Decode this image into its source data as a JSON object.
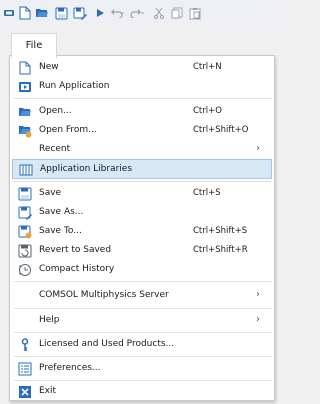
{
  "toolbar": {
    "icons": [
      "app-icon",
      "new-icon",
      "open-icon",
      "save-icon",
      "save-as-icon",
      "run-icon",
      "undo-icon",
      "redo-icon",
      "cut-icon",
      "copy-icon",
      "paste-icon"
    ]
  },
  "file_tab": {
    "label": "File"
  },
  "menu": {
    "new": {
      "label": "New",
      "shortcut": "Ctrl+N"
    },
    "run_application": {
      "label": "Run Application"
    },
    "open": {
      "label": "Open...",
      "shortcut": "Ctrl+O"
    },
    "open_from": {
      "label": "Open From...",
      "shortcut": "Ctrl+Shift+O"
    },
    "recent": {
      "label": "Recent",
      "arrow": "›"
    },
    "application_libraries": {
      "label": "Application Libraries"
    },
    "save": {
      "label": "Save",
      "shortcut": "Ctrl+S"
    },
    "save_as": {
      "label": "Save As..."
    },
    "save_to": {
      "label": "Save To...",
      "shortcut": "Ctrl+Shift+S"
    },
    "revert_to_saved": {
      "label": "Revert to Saved",
      "shortcut": "Ctrl+Shift+R"
    },
    "compact_history": {
      "label": "Compact History"
    },
    "comsol_server": {
      "label": "COMSOL Multiphysics Server",
      "arrow": "›"
    },
    "help": {
      "label": "Help",
      "arrow": "›"
    },
    "licensed_products": {
      "label": "Licensed and Used Products..."
    },
    "preferences": {
      "label": "Preferences..."
    },
    "exit": {
      "label": "Exit"
    }
  },
  "colors": {
    "highlight": "#d9e8f5",
    "accent_blue": "#2a6ebb",
    "folder_orange": "#e8a33d"
  }
}
